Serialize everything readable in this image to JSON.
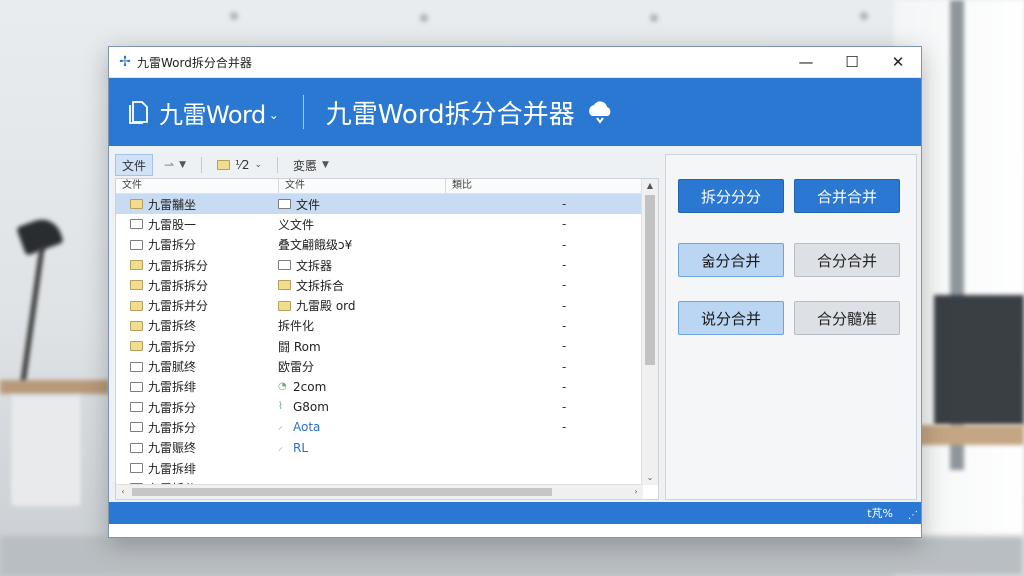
{
  "window": {
    "title": "九雷Word拆分合并器",
    "min_glyph": "—",
    "max_glyph": "☐",
    "close_glyph": "✕",
    "icon": "app-logo-icon"
  },
  "header": {
    "brand": "九雷Word",
    "brand_arrow": "⌄",
    "app_title": "九雷Word拆分合并器"
  },
  "toolbar": {
    "file_label": "文件",
    "share_label": "⇀",
    "folder_label": "⅟2",
    "edit_label": "変慝"
  },
  "columns": [
    "文件",
    "文件",
    "類比"
  ],
  "files": [
    {
      "name": "九雷黼坐",
      "type_icon": "doc",
      "type": "文件",
      "mark": "-",
      "selected": true,
      "folder": true
    },
    {
      "name": "九雷股一",
      "type_icon": "",
      "type": "义文件",
      "mark": "-",
      "folder": false
    },
    {
      "name": "九雷拆分",
      "type_icon": "",
      "type": "叠文翩餓级ɔ¥",
      "mark": "-",
      "folder": false
    },
    {
      "name": "九雷拆拆分",
      "type_icon": "doc",
      "type": "文拆器",
      "mark": "-",
      "folder": true
    },
    {
      "name": "九雷拆拆分",
      "type_icon": "folder",
      "type": "文拆拆合",
      "mark": "-",
      "folder": true
    },
    {
      "name": "九雷拆并分",
      "type_icon": "folder",
      "type": "九雷殿 ord",
      "mark": "-",
      "folder": true
    },
    {
      "name": "九雷拆终",
      "type_icon": "",
      "type": "拆件化",
      "mark": "-",
      "folder": true
    },
    {
      "name": "九雷拆分",
      "type_icon": "",
      "type": "闘 Rom",
      "mark": "-",
      "folder": true
    },
    {
      "name": "九雷腻终",
      "type_icon": "",
      "type": "欧雷分",
      "mark": "-",
      "folder": false
    },
    {
      "name": "九雷拆绯",
      "type_icon": "leaf",
      "type": "2com",
      "mark": "-",
      "folder": false
    },
    {
      "name": "九雷拆分",
      "type_icon": "chev",
      "type": "G8om",
      "mark": "-",
      "folder": false
    },
    {
      "name": "九雷拆分",
      "type_icon": "tick",
      "type": "Aota",
      "mark": "-",
      "folder": false
    },
    {
      "name": "九雷赈终",
      "type_icon": "tick",
      "type": "RL",
      "mark": "",
      "folder": false
    },
    {
      "name": "九雷拆绯",
      "type_icon": "",
      "type": "",
      "mark": "",
      "folder": false
    },
    {
      "name": "九雷拆分",
      "type_icon": "",
      "type": "",
      "mark": "",
      "folder": false
    }
  ],
  "actions": {
    "split1": "拆分分分",
    "merge1": "合并合并",
    "split_merge": "숣分合并",
    "merge_split": "合分合并",
    "say_merge": "说分合并",
    "merge_edit": "合分髓准"
  },
  "status": {
    "text": "t芃%",
    "grip": "⋰"
  },
  "colors": {
    "accent": "#2a78d1",
    "selection": "#c7dcf3",
    "light_button": "#bad6f3"
  }
}
